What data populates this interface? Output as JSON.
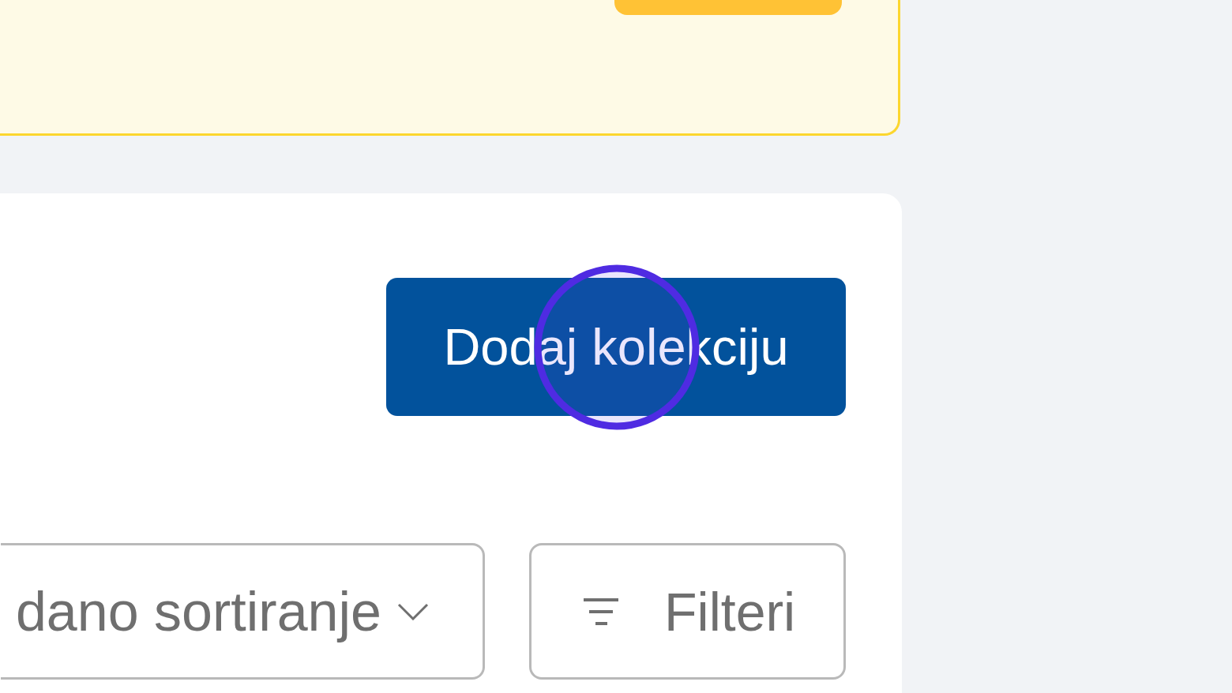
{
  "collections_panel": {
    "add_button": "Dodaj kolekciju",
    "sort_dropdown": {
      "value": "dano sortiranje"
    },
    "filter_button": "Filteri"
  }
}
